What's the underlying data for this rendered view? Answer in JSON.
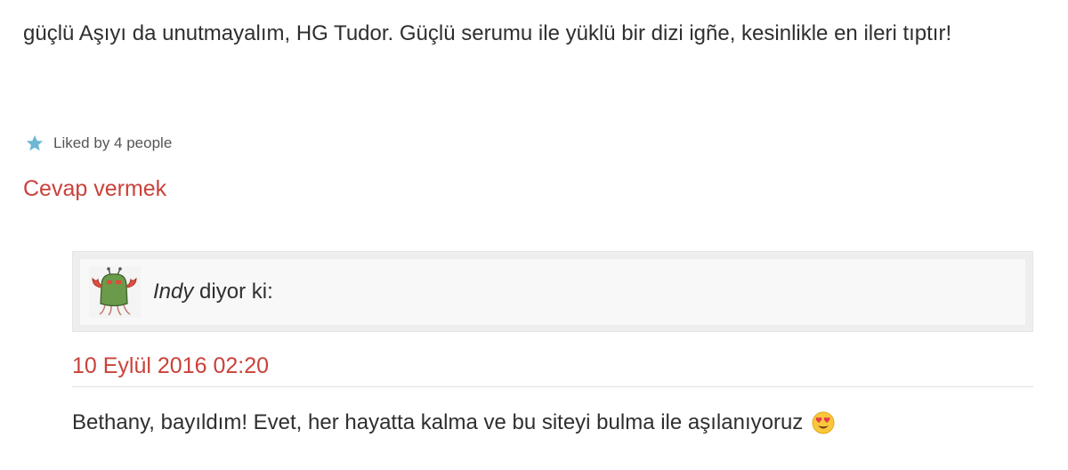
{
  "comment": {
    "text": "güçlü Aşıyı da unutmayalım, HG Tudor. Güçlü serumu ile yüklü bir dizi igñe, kesinlikle en ileri tıptır!"
  },
  "likes": {
    "icon": "star-icon",
    "text": "Liked by 4 people",
    "color": "#6bb7d4"
  },
  "reply_link": {
    "label": "Cevap vermek",
    "color": "#c9423a"
  },
  "reply": {
    "avatar_icon": "monster-avatar",
    "author": "Indy",
    "says": "diyor ki:",
    "date": "10 Eylül 2016 02:20",
    "text": "Bethany, bayıldım! Evet, her hayatta kalma ve bu siteyi bulma ile aşılanıyoruz",
    "emoji": "heart-eyes-emoji"
  }
}
